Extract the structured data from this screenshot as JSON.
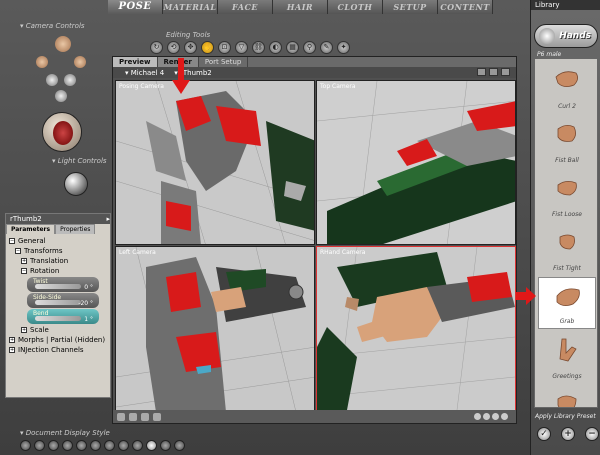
{
  "top_tabs": [
    "POSE",
    "MATERIAL",
    "FACE",
    "HAIR",
    "CLOTH",
    "SETUP",
    "CONTENT"
  ],
  "active_tab": "POSE",
  "camera_controls": {
    "title": "Camera Controls"
  },
  "light_controls": {
    "title": "Light Controls"
  },
  "editing_tools": {
    "title": "Editing Tools",
    "icons": [
      "rotate-icon",
      "twist-icon",
      "translate-icon",
      "grab-icon",
      "scale-icon",
      "taper-icon",
      "chain-break-icon",
      "color-icon",
      "grouping-icon",
      "view-magnifier-icon",
      "morphing-icon",
      "direct-manipulation-icon"
    ]
  },
  "document": {
    "tabs": [
      "Preview",
      "Render",
      "Port Setup"
    ],
    "figure_menu": "Michael 4",
    "actor_menu": "rThumb2",
    "viewports": [
      {
        "label": "Posing Camera"
      },
      {
        "label": "Top Camera"
      },
      {
        "label": "Left Camera"
      },
      {
        "label": "RHand Camera"
      }
    ]
  },
  "parameters": {
    "title": "rThumb2",
    "tabs": [
      "Parameters",
      "Properties"
    ],
    "tree": {
      "general": "General",
      "transforms": "Transforms",
      "translation": "Translation",
      "rotation": "Rotation",
      "scale": "Scale",
      "morphs": "Morphs | Partial (Hidden)",
      "injection": "INJection Channels"
    },
    "dials": [
      {
        "label": "Twist",
        "value": "0 °"
      },
      {
        "label": "Side-Side",
        "value": "-20 °"
      },
      {
        "label": "Bend",
        "value": "1 °"
      }
    ]
  },
  "document_display_style": {
    "title": "Document Display Style"
  },
  "library": {
    "title": "Library",
    "category": "Hands",
    "subfolder": "P6 male",
    "items": [
      "Curl 2",
      "Fist Ball",
      "Fist Loose",
      "Fist Tight",
      "Grab",
      "Greetings"
    ],
    "selected": "Grab",
    "apply_label": "Apply Library Preset"
  },
  "colors": {
    "accent_red": "#e01818",
    "selected_tab": "#ffd34a",
    "highlight_dial": "#5bb8b8"
  }
}
